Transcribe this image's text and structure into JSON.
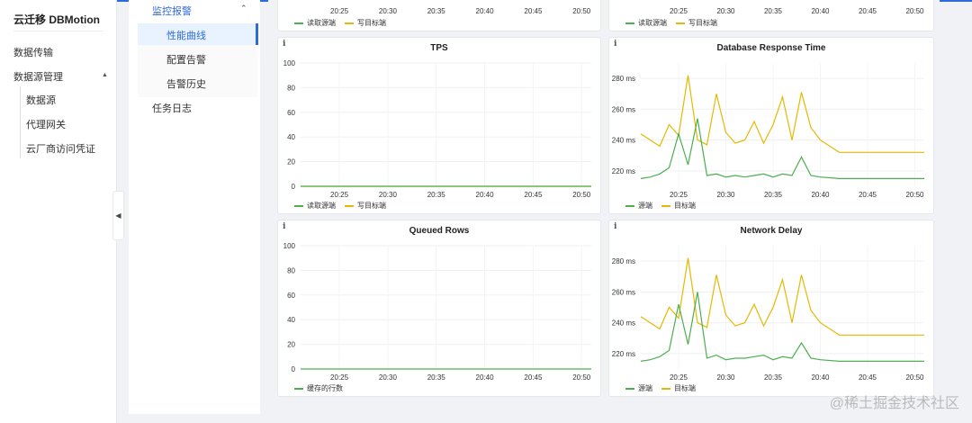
{
  "app": {
    "title": "云迁移 DBMotion"
  },
  "nav": {
    "items": [
      {
        "label": "数据传输"
      },
      {
        "label": "数据源管理"
      }
    ],
    "sub_items": [
      {
        "label": "数据源"
      },
      {
        "label": "代理网关"
      },
      {
        "label": "云厂商访问凭证"
      }
    ]
  },
  "panel2": {
    "group_label": "监控报警",
    "items": [
      {
        "label": "性能曲线"
      },
      {
        "label": "配置告警"
      },
      {
        "label": "告警历史"
      }
    ],
    "task_log_label": "任务日志"
  },
  "colors": {
    "green": "#4caf50",
    "yellow": "#e6b800",
    "accent": "#2f6bd8"
  },
  "icons": {
    "info": "info-icon",
    "collapse": "chevron-left-icon",
    "caret": "chevron-up-icon"
  },
  "charts": {
    "top_left": {
      "legend": [
        "读取源端",
        "写目标端"
      ],
      "x_ticks": [
        "20:25",
        "20:30",
        "20:35",
        "20:40",
        "20:45",
        "20:50"
      ]
    },
    "top_right": {
      "legend": [
        "读取源端",
        "写目标端"
      ],
      "x_ticks": [
        "20:25",
        "20:30",
        "20:35",
        "20:40",
        "20:45",
        "20:50"
      ]
    }
  },
  "chart_data": [
    {
      "type": "line",
      "title": "TPS",
      "x": [
        "20:21",
        "20:25",
        "20:30",
        "20:35",
        "20:40",
        "20:45",
        "20:50",
        "20:51"
      ],
      "x_ticks": [
        "20:25",
        "20:30",
        "20:35",
        "20:40",
        "20:45",
        "20:50"
      ],
      "y_ticks": [
        "0",
        "20",
        "40",
        "60",
        "80",
        "100"
      ],
      "ylim": [
        0,
        100
      ],
      "series": [
        {
          "name": "读取源端",
          "color": "#4caf50",
          "values": [
            0,
            0,
            0,
            0,
            0,
            0,
            0,
            0
          ]
        },
        {
          "name": "写目标端",
          "color": "#e6b800",
          "values": [
            0,
            0,
            0,
            0,
            0,
            0,
            0,
            0
          ]
        }
      ]
    },
    {
      "type": "line",
      "title": "Database Response Time",
      "x": [
        "20:21",
        "20:22",
        "20:23",
        "20:24",
        "20:25",
        "20:26",
        "20:27",
        "20:28",
        "20:29",
        "20:30",
        "20:31",
        "20:32",
        "20:33",
        "20:34",
        "20:35",
        "20:36",
        "20:37",
        "20:38",
        "20:39",
        "20:40",
        "20:42",
        "20:45",
        "20:48",
        "20:50",
        "20:51"
      ],
      "x_ticks": [
        "20:25",
        "20:30",
        "20:35",
        "20:40",
        "20:45",
        "20:50"
      ],
      "y_ticks": [
        "220 ms",
        "240 ms",
        "260 ms",
        "280 ms"
      ],
      "ylim": [
        210,
        290
      ],
      "series": [
        {
          "name": "源端",
          "color": "#4caf50",
          "values": [
            215,
            216,
            218,
            222,
            244,
            224,
            254,
            217,
            218,
            216,
            217,
            216,
            217,
            218,
            216,
            218,
            217,
            229,
            217,
            216,
            215,
            215,
            215,
            215,
            215
          ]
        },
        {
          "name": "目标端",
          "color": "#e6b800",
          "values": [
            244,
            240,
            236,
            250,
            243,
            282,
            240,
            237,
            270,
            245,
            238,
            240,
            252,
            238,
            250,
            268,
            240,
            271,
            248,
            240,
            232,
            232,
            232,
            232,
            232
          ]
        }
      ]
    },
    {
      "type": "line",
      "title": "Queued Rows",
      "x": [
        "20:21",
        "20:25",
        "20:30",
        "20:35",
        "20:40",
        "20:45",
        "20:50",
        "20:51"
      ],
      "x_ticks": [
        "20:25",
        "20:30",
        "20:35",
        "20:40",
        "20:45",
        "20:50"
      ],
      "y_ticks": [
        "0",
        "20",
        "40",
        "60",
        "80",
        "100"
      ],
      "ylim": [
        0,
        100
      ],
      "series": [
        {
          "name": "缓存的行数",
          "color": "#4caf50",
          "values": [
            0,
            0,
            0,
            0,
            0,
            0,
            0,
            0
          ]
        }
      ]
    },
    {
      "type": "line",
      "title": "Network Delay",
      "x": [
        "20:21",
        "20:22",
        "20:23",
        "20:24",
        "20:25",
        "20:26",
        "20:27",
        "20:28",
        "20:29",
        "20:30",
        "20:31",
        "20:32",
        "20:33",
        "20:34",
        "20:35",
        "20:36",
        "20:37",
        "20:38",
        "20:39",
        "20:40",
        "20:42",
        "20:45",
        "20:48",
        "20:50",
        "20:51"
      ],
      "x_ticks": [
        "20:25",
        "20:30",
        "20:35",
        "20:40",
        "20:45",
        "20:50"
      ],
      "y_ticks": [
        "220 ms",
        "240 ms",
        "260 ms",
        "280 ms"
      ],
      "ylim": [
        210,
        290
      ],
      "series": [
        {
          "name": "源端",
          "color": "#4caf50",
          "values": [
            215,
            216,
            218,
            222,
            252,
            226,
            260,
            217,
            219,
            216,
            217,
            217,
            218,
            219,
            216,
            218,
            217,
            227,
            217,
            216,
            215,
            215,
            215,
            215,
            215
          ]
        },
        {
          "name": "目标端",
          "color": "#e6b800",
          "values": [
            244,
            240,
            236,
            250,
            243,
            282,
            240,
            237,
            271,
            245,
            238,
            240,
            252,
            238,
            250,
            268,
            240,
            271,
            248,
            240,
            232,
            232,
            232,
            232,
            232
          ]
        }
      ]
    }
  ],
  "watermark": "@稀土掘金技术社区"
}
